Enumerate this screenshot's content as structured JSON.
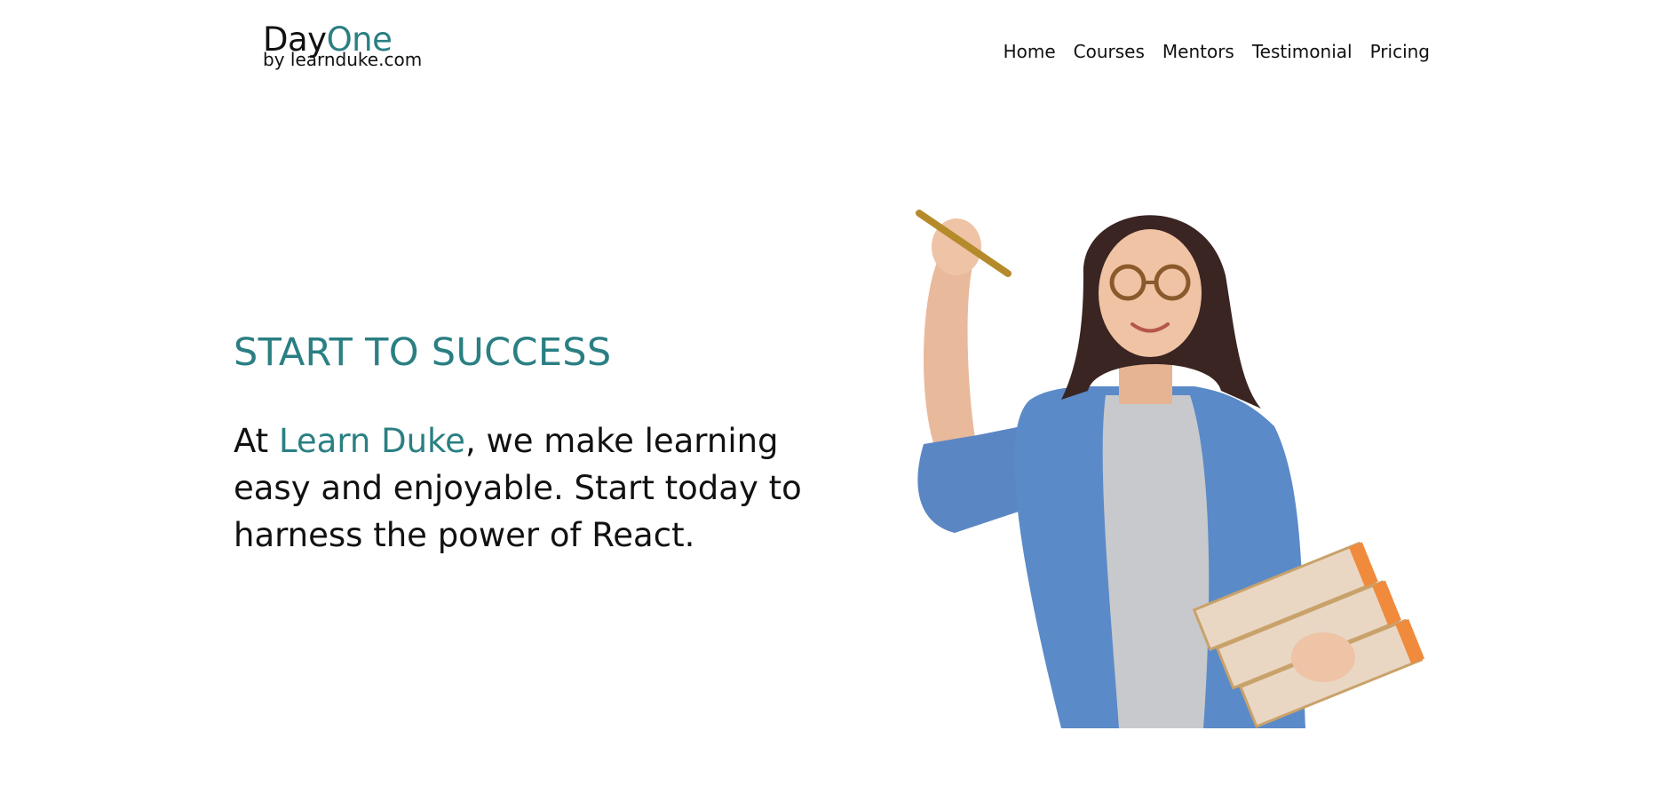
{
  "header": {
    "logo": {
      "part1": "Day",
      "part2": "One",
      "sub": "by learnduke.com"
    },
    "nav": [
      "Home",
      "Courses",
      "Mentors",
      "Testimonial",
      "Pricing"
    ]
  },
  "hero": {
    "kicker": "START TO SUCCESS",
    "text_pre": "At ",
    "text_brand": "Learn Duke",
    "text_post": ", we make learning easy and enjoyable. Start today to harness the power of React."
  },
  "colors": {
    "accent": "#2a7f83",
    "text": "#111111",
    "background": "#ffffff"
  }
}
